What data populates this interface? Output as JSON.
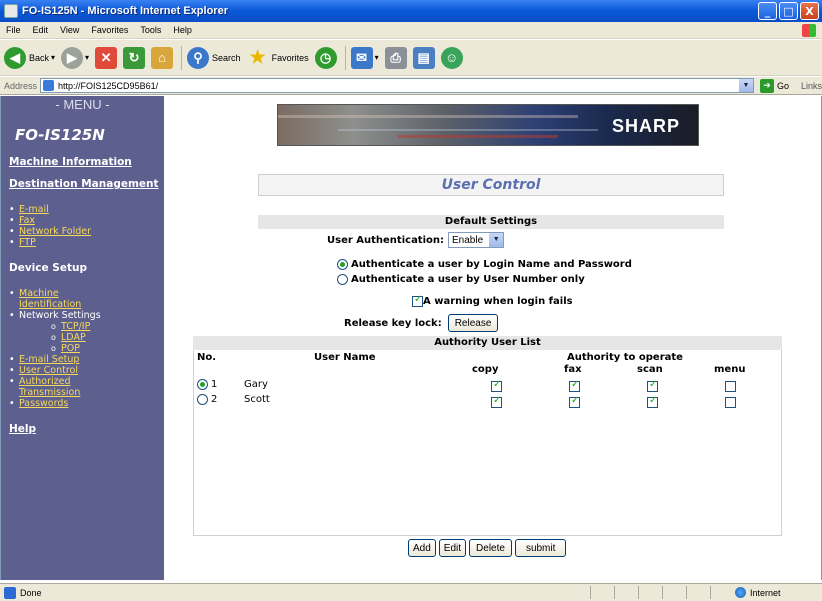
{
  "window": {
    "title": "FO-IS125N - Microsoft Internet Explorer",
    "controls": {
      "minimize": "_",
      "maximize": "□",
      "close": "X"
    }
  },
  "menubar": [
    "File",
    "Edit",
    "View",
    "Favorites",
    "Tools",
    "Help"
  ],
  "toolbar": {
    "back": "Back",
    "search": "Search",
    "favorites": "Favorites"
  },
  "address": {
    "label": "Address",
    "url": "http://FOIS125CD95B61/",
    "go": "Go",
    "links": "Links"
  },
  "sidebar": {
    "menu_header": "- MENU -",
    "model": "FO-IS125N",
    "machine_information": "Machine Information",
    "destination_management": "Destination Management",
    "destination_items": [
      "E-mail",
      "Fax",
      "Network Folder",
      "FTP"
    ],
    "device_setup": "Device Setup",
    "device_items": {
      "machine_id_1": "Machine",
      "machine_id_2": "Identification",
      "network_settings": "Network Settings",
      "tcpip": "TCP/IP",
      "ldap": "LDAP",
      "pop": "POP",
      "email_setup": "E-mail Setup",
      "user_control": "User Control",
      "authorized_1": "Authorized",
      "authorized_2": "Transmission",
      "passwords": "Passwords"
    },
    "help": "Help"
  },
  "main": {
    "brand": "SHARP",
    "page_title": "User Control",
    "default_settings": "Default Settings",
    "user_auth_label": "User Authentication:",
    "user_auth_value": "Enable",
    "radio_login": "Authenticate a user by Login Name and Password",
    "radio_number": "Authenticate a user by User Number only",
    "warning_label": "A warning when login fails",
    "release_label": "Release key lock:",
    "release_button": "Release",
    "authority_header": "Authority User List",
    "columns": {
      "no": "No.",
      "user_name": "User Name",
      "authority": "Authority to operate",
      "copy": "copy",
      "fax": "fax",
      "scan": "scan",
      "menu": "menu"
    },
    "users": [
      {
        "no": "1",
        "name": "Gary",
        "selected": true,
        "copy": true,
        "fax": true,
        "scan": true,
        "menu": false
      },
      {
        "no": "2",
        "name": "Scott",
        "selected": false,
        "copy": true,
        "fax": true,
        "scan": true,
        "menu": false
      }
    ],
    "buttons": {
      "add": "Add",
      "edit": "Edit",
      "delete": "Delete",
      "submit": "submit"
    }
  },
  "status": {
    "text": "Done",
    "zone": "Internet"
  }
}
